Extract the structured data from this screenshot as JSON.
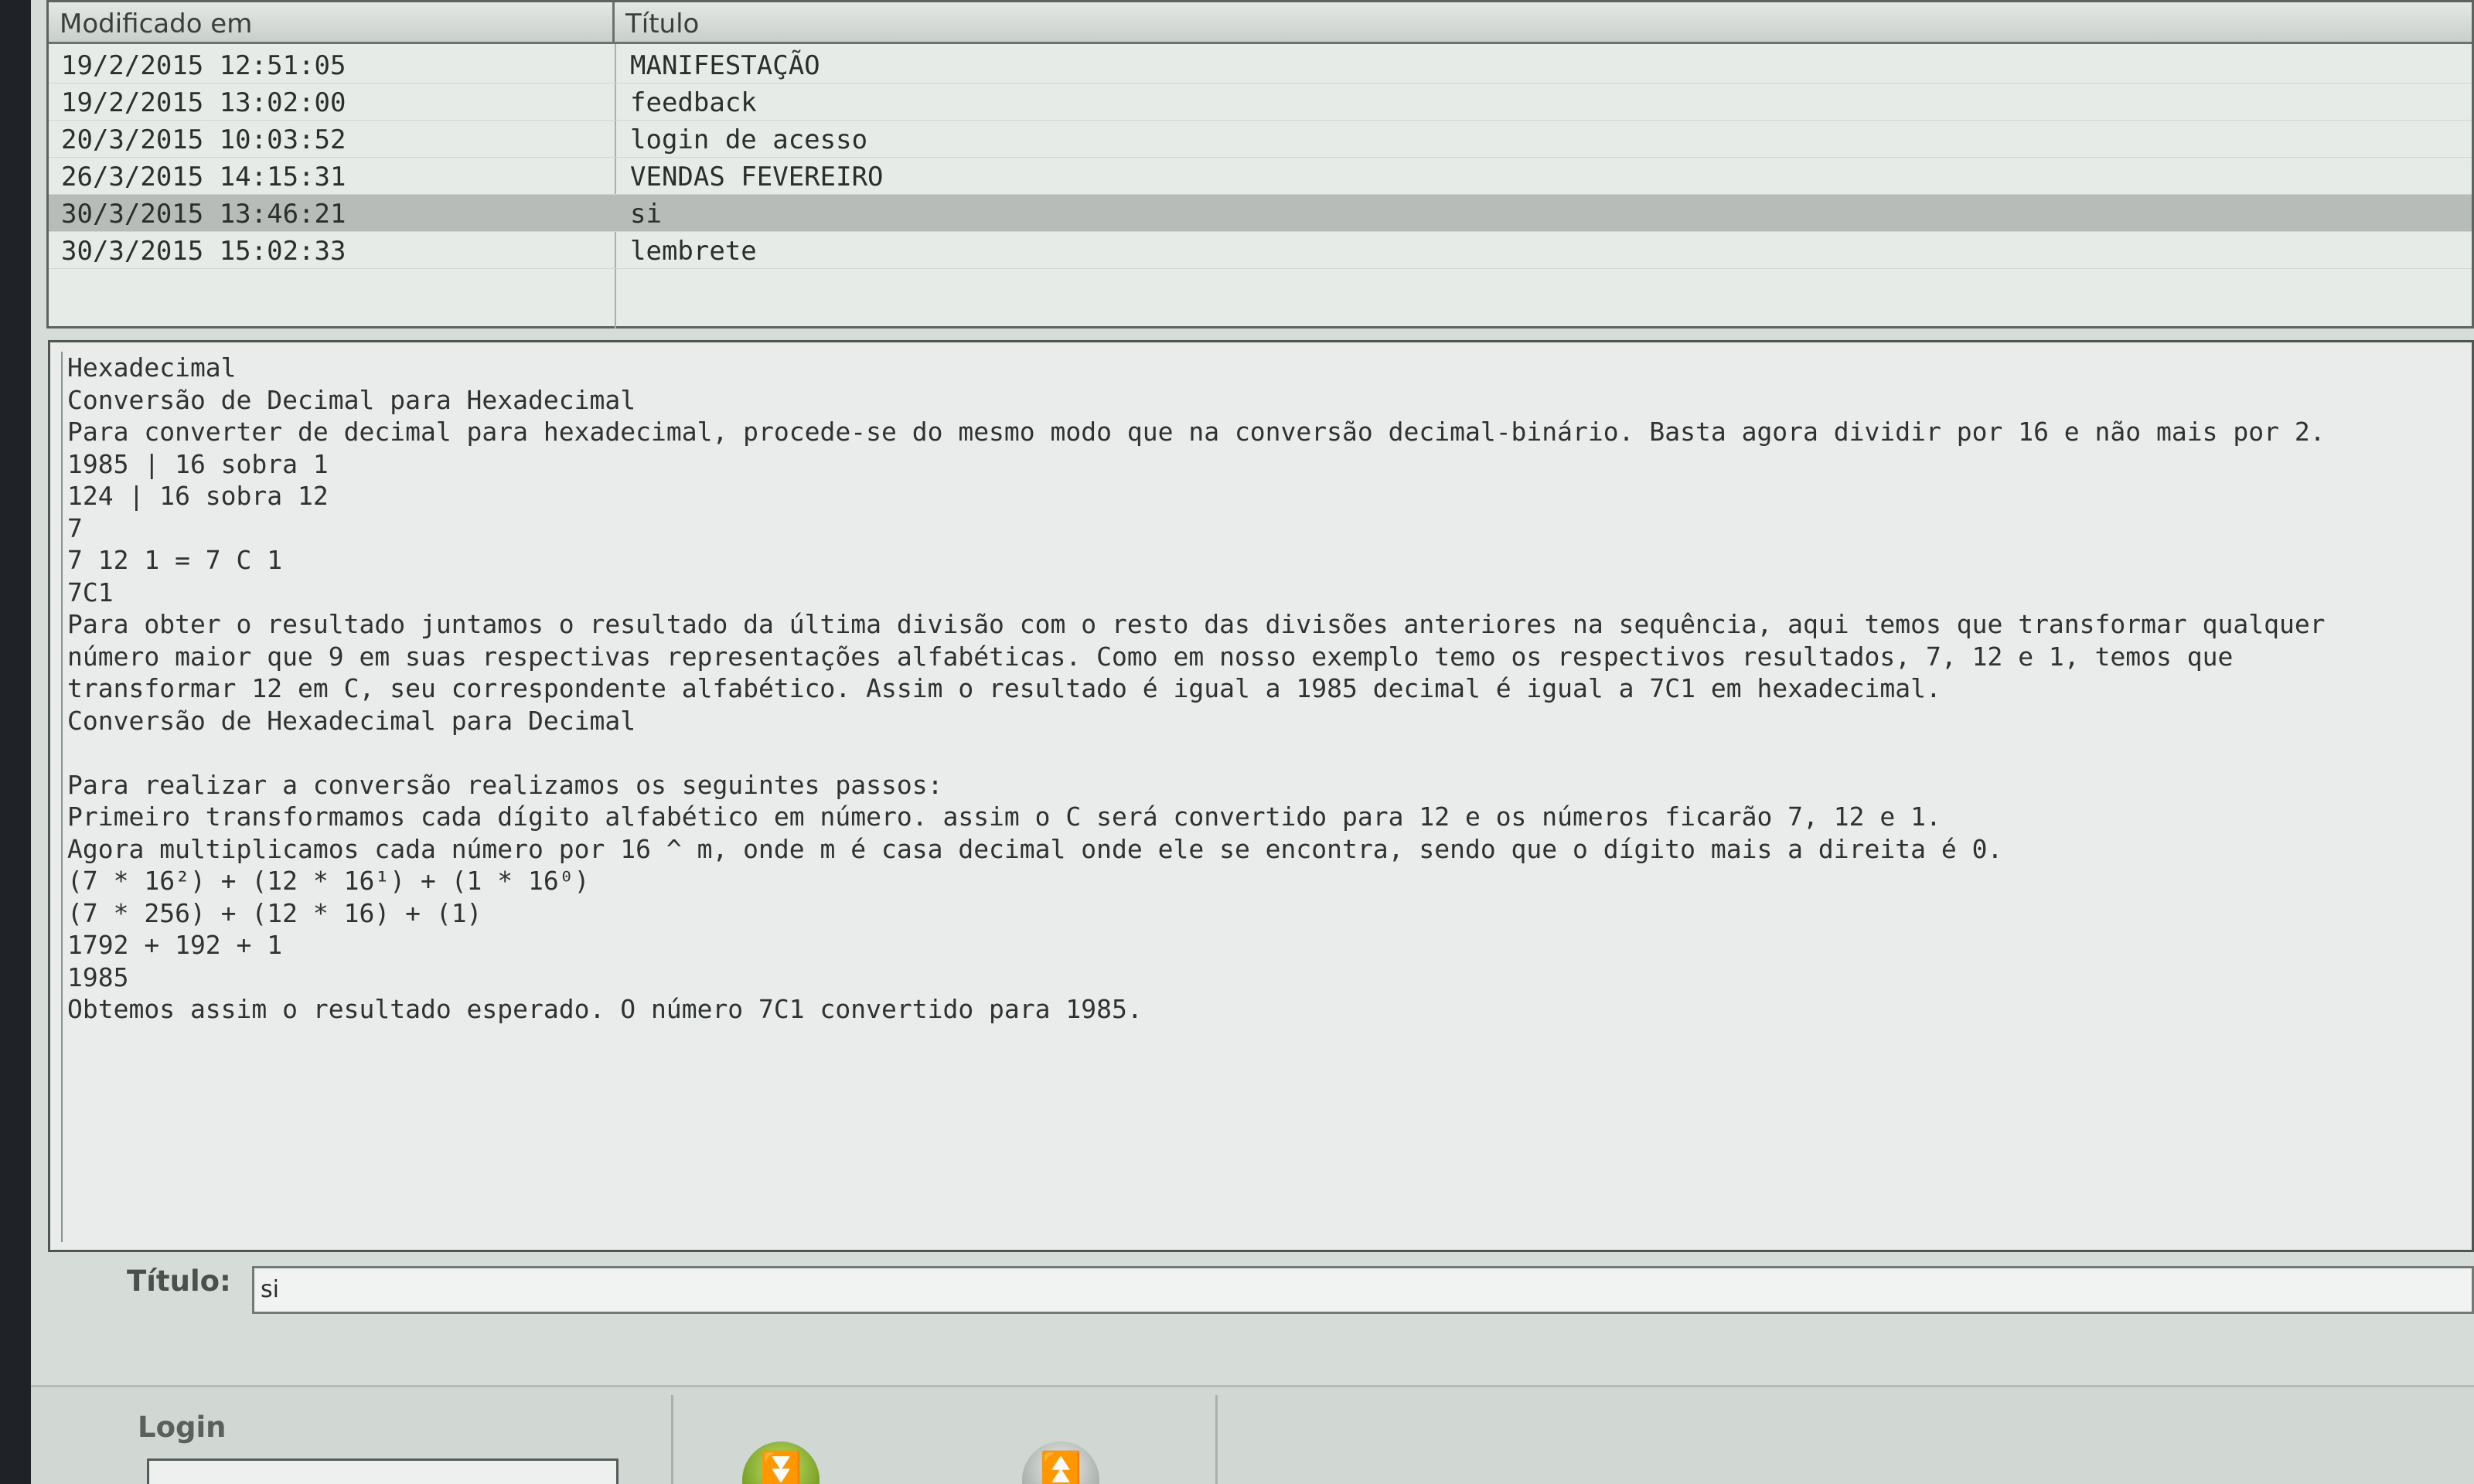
{
  "table": {
    "col_date": "Modificado em",
    "col_title": "Título",
    "rows": [
      {
        "date": "19/2/2015 12:51:05",
        "title": "MANIFESTAÇÃO"
      },
      {
        "date": "19/2/2015 13:02:00",
        "title": "feedback"
      },
      {
        "date": "20/3/2015 10:03:52",
        "title": "login de acesso"
      },
      {
        "date": "26/3/2015 14:15:31",
        "title": "VENDAS FEVEREIRO"
      },
      {
        "date": "30/3/2015 13:46:21",
        "title": "si"
      },
      {
        "date": "30/3/2015 15:02:33",
        "title": "lembrete"
      }
    ],
    "selected_index": 4
  },
  "note": {
    "lines": [
      "Hexadecimal",
      "Conversão de Decimal para Hexadecimal",
      "Para converter de decimal para hexadecimal, procede-se do mesmo modo que na conversão decimal-binário. Basta agora dividir por 16 e não mais por 2.",
      "1985 | 16 sobra 1",
      "124 | 16 sobra 12",
      "7",
      "7 12 1 = 7 C 1",
      "7C1",
      "Para obter o resultado juntamos o resultado da última divisão com o resto das divisões anteriores na sequência, aqui temos que transformar qualquer",
      "número maior que 9 em suas respectivas representações alfabéticas. Como em nosso exemplo temo os respectivos resultados, 7, 12 e 1, temos que",
      "transformar 12 em C, seu correspondente alfabético. Assim o resultado é igual a 1985 decimal é igual a 7C1 em hexadecimal.",
      "Conversão de Hexadecimal para Decimal",
      "",
      "Para realizar a conversão realizamos os seguintes passos:",
      "Primeiro transformamos cada dígito alfabético em número. assim o C será convertido para 12 e os números ficarão 7, 12 e 1.",
      "Agora multiplicamos cada número por 16 ^ m, onde m é casa decimal onde ele se encontra, sendo que o dígito mais a direita é 0.",
      "(7 * 16²) + (12 * 16¹) + (1 * 16⁰)",
      "(7 * 256) + (12 * 16) + (1)",
      "1792 + 192 + 1",
      "1985",
      "Obtemos assim o resultado esperado. O número 7C1 convertido para 1985."
    ]
  },
  "title_field": {
    "label": "Título:",
    "value": "si"
  },
  "login": {
    "label": "Login",
    "value": ""
  },
  "buttons": {
    "confirm_icon": "chevron-down-icon",
    "up_icon": "chevron-up-icon"
  },
  "colors": {
    "selected_row": "#b7bcb9",
    "confirm_button": "#8fbf2a"
  }
}
